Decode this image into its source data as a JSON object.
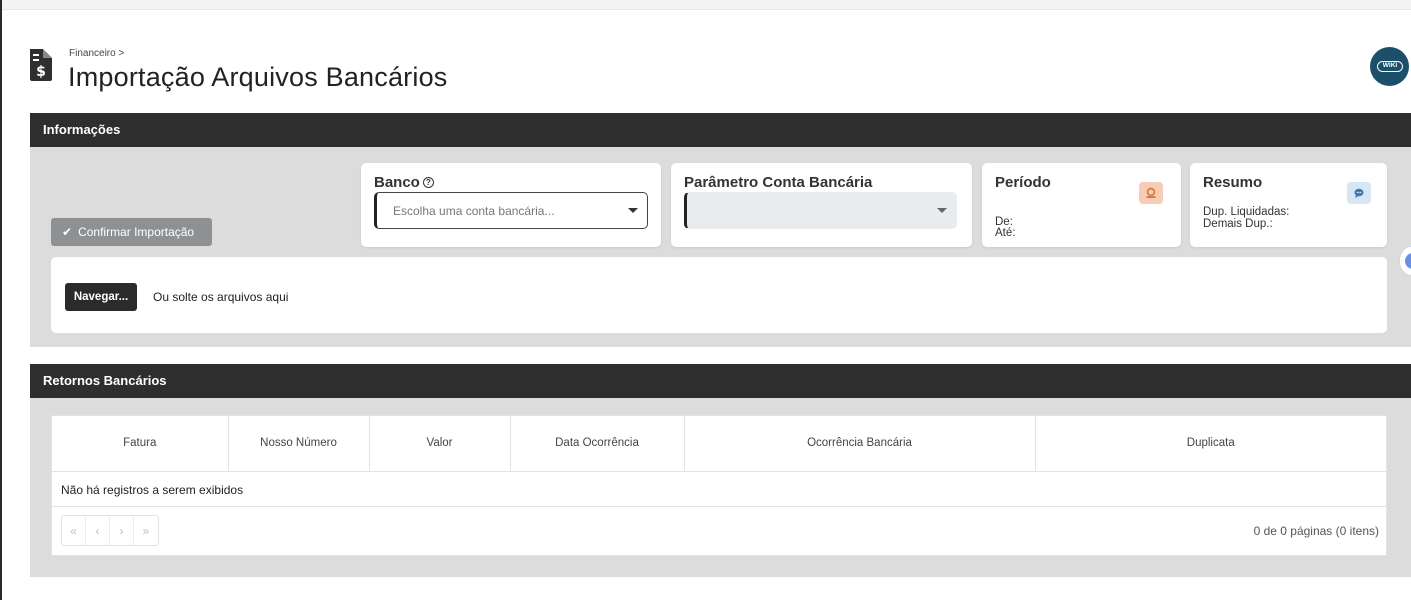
{
  "header": {
    "breadcrumb": "Financeiro >",
    "title": "Importação Arquivos Bancários",
    "wiki_label": "WIKI",
    "icon": "invoice-dollar-icon"
  },
  "informacoes": {
    "section_title": "Informações",
    "confirm_label": "Confirmar Importação",
    "banco": {
      "title": "Banco",
      "placeholder": "Escolha uma conta bancária..."
    },
    "parametro": {
      "title": "Parâmetro Conta Bancária",
      "value": ""
    },
    "periodo": {
      "title": "Período",
      "de_label": "De:",
      "ate_label": "Até:",
      "icon": "calendar-icon",
      "icon_color": "#f6cdb4"
    },
    "resumo": {
      "title": "Resumo",
      "liquidadas_label": "Dup. Liquidadas:",
      "demais_label": "Demais Dup.:",
      "icon": "chat-icon",
      "icon_color": "#d6e6f3"
    },
    "upload": {
      "browse_label": "Navegar...",
      "drop_text": "Ou solte os arquivos aqui"
    }
  },
  "retornos": {
    "section_title": "Retornos Bancários",
    "columns": [
      "Fatura",
      "Nosso Número",
      "Valor",
      "Data Ocorrência",
      "Ocorrência Bancária",
      "Duplicata"
    ],
    "empty_message": "Não há registros a serem exibidos",
    "pager": {
      "first": "«",
      "prev": "‹",
      "next": "›",
      "last": "»",
      "info": "0 de 0 páginas (0 itens)"
    }
  },
  "colors": {
    "section_bar": "#2e2e2e",
    "body_bg": "#dcdcdc",
    "wiki_bg": "#1c4f69"
  }
}
